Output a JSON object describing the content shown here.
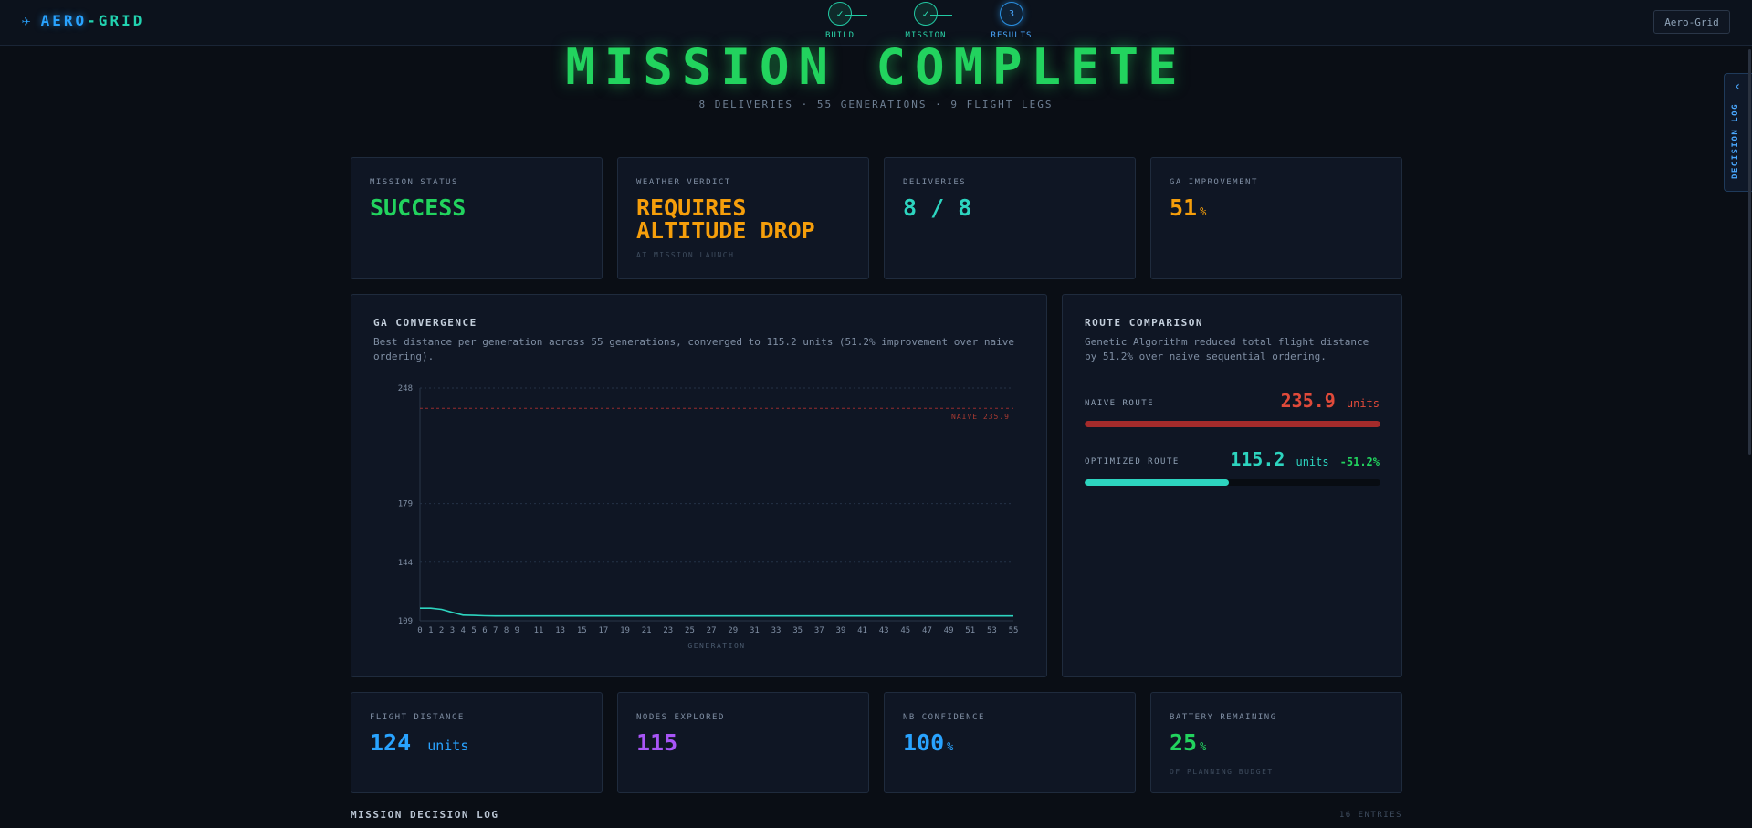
{
  "app": {
    "brand_part1": "AERO",
    "brand_part2": "-GRID",
    "top_button": "Aero-Grid"
  },
  "stepper": {
    "steps": [
      {
        "label": "BUILD",
        "state": "done",
        "icon": "check-icon"
      },
      {
        "label": "MISSION",
        "state": "done",
        "icon": "check-icon"
      },
      {
        "label": "RESULTS",
        "state": "active",
        "number": "3"
      }
    ]
  },
  "hero": {
    "title": "MISSION COMPLETE",
    "subtitle": "8 DELIVERIES · 55 GENERATIONS · 9 FLIGHT LEGS"
  },
  "kpis_top": [
    {
      "label": "MISSION STATUS",
      "value": "SUCCESS",
      "unit": "",
      "note": "",
      "color": "#22d35e"
    },
    {
      "label": "WEATHER VERDICT",
      "value": "REQUIRES ALTITUDE DROP",
      "unit": "",
      "note": "AT MISSION LAUNCH",
      "color": "#f59e0b"
    },
    {
      "label": "DELIVERIES",
      "value": "8 / 8",
      "unit": "",
      "note": "",
      "color": "#2dd4bf"
    },
    {
      "label": "GA IMPROVEMENT",
      "value": "51",
      "unit": "%",
      "note": "",
      "color": "#f59e0b"
    }
  ],
  "convergence": {
    "title": "GA CONVERGENCE",
    "description": "Best distance per generation across 55 generations, converged to 115.2 units (51.2% improvement over naive ordering).",
    "naive_label": "NAIVE 235.9"
  },
  "chart_data": {
    "type": "line",
    "xlabel": "GENERATION",
    "ylabel": "",
    "ylim": [
      109,
      248
    ],
    "yticks": [
      109,
      144,
      179,
      248
    ],
    "xticks": [
      0,
      1,
      2,
      3,
      4,
      5,
      6,
      7,
      8,
      9,
      11,
      13,
      15,
      17,
      19,
      21,
      23,
      25,
      27,
      29,
      31,
      33,
      35,
      37,
      39,
      41,
      43,
      45,
      47,
      49,
      51,
      53,
      55
    ],
    "x": [
      0,
      1,
      2,
      3,
      4,
      5,
      6,
      7,
      8,
      9,
      10,
      15,
      20,
      25,
      30,
      35,
      40,
      45,
      50,
      55
    ],
    "series": [
      {
        "values": [
          116.5,
          116.5,
          115.8,
          114.0,
          112.4,
          112.2,
          112.0,
          111.9,
          111.9,
          111.9,
          111.9,
          111.9,
          111.9,
          111.9,
          111.9,
          111.9,
          111.9,
          111.9,
          111.9,
          111.9
        ],
        "color": "#2dd4bf"
      }
    ],
    "reference_line": {
      "value": 235.9,
      "label": "NAIVE 235.9",
      "color": "#b83232"
    },
    "grid": true
  },
  "route": {
    "title": "ROUTE COMPARISON",
    "description": "Genetic Algorithm reduced total flight distance by 51.2% over naive sequential ordering.",
    "naive": {
      "label": "NAIVE ROUTE",
      "value": "235.9",
      "unit": "units",
      "fraction": 1.0,
      "color": "#e04a3a"
    },
    "optimized": {
      "label": "OPTIMIZED ROUTE",
      "value": "115.2",
      "unit": "units",
      "delta": "-51.2%",
      "fraction": 0.488,
      "color": "#2dd4bf",
      "delta_color": "#22d35e"
    }
  },
  "kpis_bottom": [
    {
      "label": "FLIGHT DISTANCE",
      "value": "124",
      "unit": "units",
      "note": "",
      "color": "#29a3ff"
    },
    {
      "label": "NODES EXPLORED",
      "value": "115",
      "unit": "",
      "note": "",
      "color": "#a855f7"
    },
    {
      "label": "NB CONFIDENCE",
      "value": "100",
      "unit": "%",
      "note": "",
      "color": "#29a3ff"
    },
    {
      "label": "BATTERY REMAINING",
      "value": "25",
      "unit": "%",
      "note": "OF PLANNING BUDGET",
      "color": "#22d35e"
    }
  ],
  "decision_log": {
    "title": "MISSION DECISION LOG",
    "count": "16 ENTRIES",
    "tab_label": "DECISION LOG"
  }
}
